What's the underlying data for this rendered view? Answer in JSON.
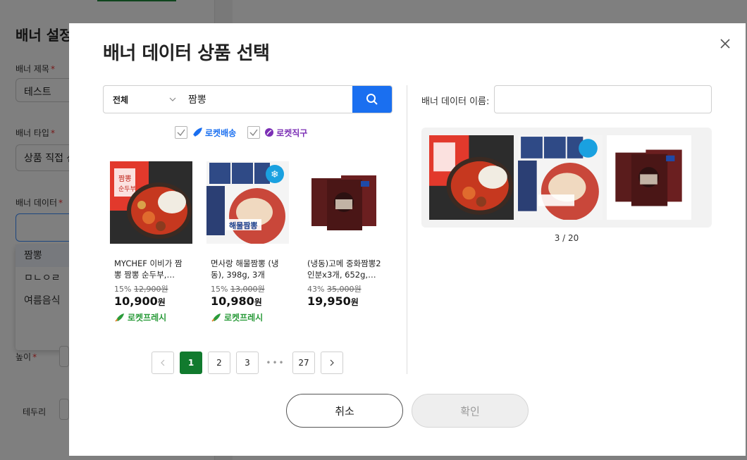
{
  "background": {
    "title": "배너 설정",
    "fields": [
      {
        "label": "배너 제목",
        "value": "테스트"
      },
      {
        "label": "배너 타입",
        "value": "상품 직접 선"
      },
      {
        "label": "배너 데이터",
        "value": ""
      },
      {
        "label": "높이",
        "value": ""
      },
      {
        "label": "테두리",
        "value": ""
      }
    ],
    "dropdown_options": [
      "짬뽕",
      "ㅁㄴㅇㄹ",
      "여름음식"
    ]
  },
  "modal": {
    "title": "배너 데이터 상품 선택",
    "close_icon": "close-icon",
    "search": {
      "category": "전체",
      "query": "짬뽕"
    },
    "filters": [
      {
        "label": "로켓배송",
        "checked": true,
        "color": "#1a6ff0",
        "icon": "rocket-icon"
      },
      {
        "label": "로켓직구",
        "checked": true,
        "color": "#7b2fb5",
        "icon": "rocket-global-icon"
      }
    ],
    "products": [
      {
        "name": "MYCHEF 이비가 짬뽕 짬뽕 순두부, 1005g…",
        "discount": "15%",
        "original_price": "12,900원",
        "price": "10,900",
        "won": "원",
        "badge": "로켓프레시"
      },
      {
        "name": "면사랑 해물짬뽕 (냉동), 398g, 3개",
        "discount": "15%",
        "original_price": "13,000원",
        "price": "10,980",
        "won": "원",
        "badge": "로켓프레시"
      },
      {
        "name": "(냉동)고메 중화짬뽕2인분x3개, 652g, 1…",
        "discount": "43%",
        "original_price": "35,000원",
        "price": "19,950",
        "won": "원",
        "badge": ""
      }
    ],
    "pagination": {
      "prev": "<",
      "pages": [
        "1",
        "2",
        "3"
      ],
      "current": "1",
      "ellipsis": "•••",
      "last": "27",
      "next": ">"
    },
    "banner_name": {
      "label": "배너 데이터 이름:",
      "value": ""
    },
    "selected_count": "3 / 20",
    "buttons": {
      "cancel": "취소",
      "confirm": "확인"
    }
  }
}
